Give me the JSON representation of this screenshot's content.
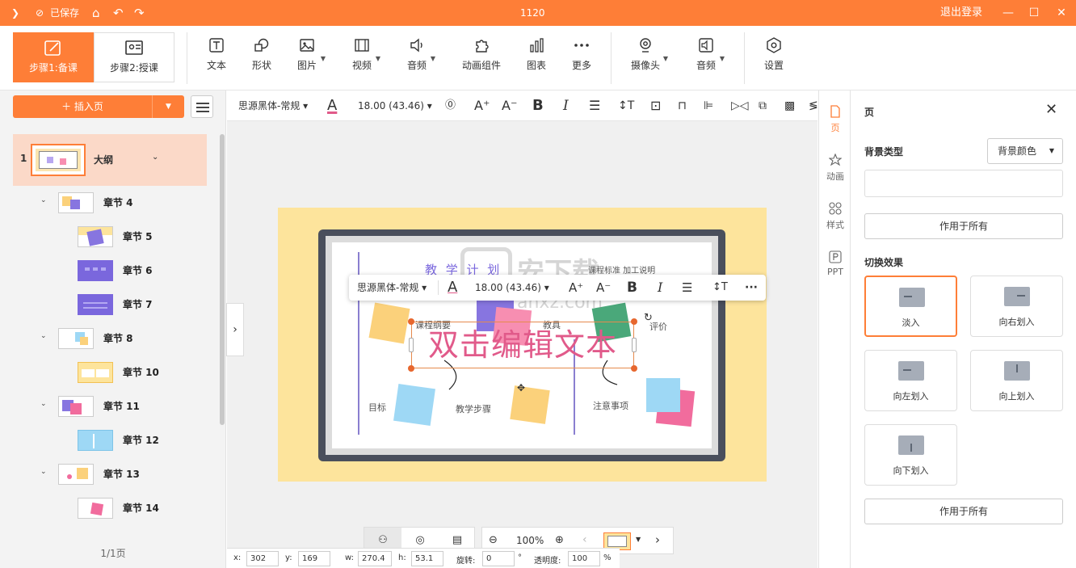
{
  "titlebar": {
    "saved": "已保存",
    "title": "1120",
    "logout": "退出登录"
  },
  "toolbar": {
    "step1": "步骤1:备课",
    "step2": "步骤2:授课",
    "items": [
      "文本",
      "形状",
      "图片",
      "视频",
      "音频",
      "动画组件",
      "图表",
      "更多",
      "摄像头",
      "音频",
      "设置"
    ]
  },
  "left": {
    "insert_page": "插入页",
    "outline": [
      {
        "num": "1",
        "name": "大纲"
      },
      {
        "name": "章节 4"
      },
      {
        "name": "章节 5"
      },
      {
        "name": "章节 6"
      },
      {
        "name": "章节 7"
      },
      {
        "name": "章节 8"
      },
      {
        "name": "章节 10"
      },
      {
        "name": "章节 11"
      },
      {
        "name": "章节 12"
      },
      {
        "name": "章节 13"
      },
      {
        "name": "章节 14"
      }
    ],
    "page_count": "1/1页"
  },
  "format": {
    "font": "思源黑体-常规",
    "size": "18.00 (43.46)"
  },
  "slide": {
    "title": "教 学 计 划",
    "labels": [
      "课程纲要",
      "教具",
      "评价",
      "目标",
      "教学步骤",
      "注意事项",
      "课程标准 加工说明"
    ],
    "textbox": "双击编辑文本"
  },
  "floatbar": {
    "font": "思源黑体-常规",
    "size": "18.00 (43.46)"
  },
  "watermark": {
    "text": "安下载",
    "url": "anxz.com"
  },
  "zoom": "100%",
  "coords": {
    "x_label": "x:",
    "x": "302",
    "y_label": "y:",
    "y": "169",
    "w_label": "w:",
    "w": "270.4",
    "h_label": "h:",
    "h": "53.1",
    "rot_label": "旋转:",
    "rot": "0",
    "deg": "°",
    "op_label": "透明度:",
    "op": "100",
    "pct": "%"
  },
  "sidetabs": [
    "页",
    "动画",
    "样式",
    "PPT"
  ],
  "rightpanel": {
    "title": "页",
    "bg_type_label": "背景类型",
    "bg_type_value": "背景颜色",
    "apply_all": "作用于所有",
    "transition_label": "切换效果",
    "transitions": [
      "淡入",
      "向右划入",
      "向左划入",
      "向上划入",
      "向下划入"
    ],
    "apply_all2": "作用于所有"
  },
  "colors": {
    "accent": "#fe7e37",
    "slide_bg": "#fde49c",
    "board": "#4a4f5c",
    "text_pink": "#e15a8a"
  }
}
